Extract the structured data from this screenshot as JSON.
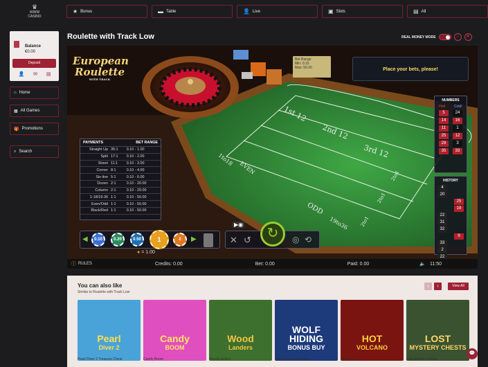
{
  "brand": {
    "line1": "WWW",
    "line2": "CASINO"
  },
  "topnav": [
    {
      "icon": "star-icon",
      "glyph": "★",
      "label": "Bonus"
    },
    {
      "icon": "table-icon",
      "glyph": "▬",
      "label": "Table"
    },
    {
      "icon": "live-icon",
      "glyph": "👤",
      "label": "Live"
    },
    {
      "icon": "slots-icon",
      "glyph": "▣",
      "label": "Slots"
    },
    {
      "icon": "all-icon",
      "glyph": "▤",
      "label": "All"
    }
  ],
  "sidebar": {
    "balance_label": "Balance",
    "balance_value": "€0.00",
    "deposit_label": "Deposit",
    "items": [
      {
        "icon": "home-icon",
        "glyph": "⌂",
        "label": "Home"
      },
      {
        "icon": "grid-icon",
        "glyph": "▦",
        "label": "All Games"
      },
      {
        "icon": "gift-icon",
        "glyph": "🎁",
        "label": "Promotions"
      }
    ],
    "search_label": "Search"
  },
  "page": {
    "title": "Roulette with Track Low",
    "real_money_label": "REAL MONEY MODE"
  },
  "game": {
    "logo_line1": "European",
    "logo_line2": "Roulette",
    "logo_line3": "WITH TRACK",
    "message": "Place your bets, please!",
    "bet_range": {
      "title": "Bet Range",
      "min": "Min: 0.10",
      "max": "Max: 50.00"
    },
    "paytable": {
      "h1": "PAYMENTS",
      "h2": "BET RANGE",
      "rows": [
        [
          "Straight Up",
          "35:1",
          "0.10 - 1.00"
        ],
        [
          "Split",
          "17:1",
          "0.10 - 2.00"
        ],
        [
          "Street",
          "11:1",
          "0.10 - 3.00"
        ],
        [
          "Corner",
          "8:1",
          "0.10 - 4.00"
        ],
        [
          "Six-line",
          "5:1",
          "0.10 - 6.00"
        ],
        [
          "Dozen",
          "2:1",
          "0.10 - 20.00"
        ],
        [
          "Column",
          "2:1",
          "0.10 - 20.00"
        ],
        [
          "1-18/19-36",
          "1:1",
          "0.10 - 50.00"
        ],
        [
          "Even/Odd",
          "1:1",
          "0.10 - 50.00"
        ],
        [
          "Black/Red",
          "1:1",
          "0.10 - 50.00"
        ]
      ]
    },
    "numbers": {
      "title": "NUMBERS",
      "hot_label": "Hot!",
      "cold_label": "Cold!",
      "hot": [
        "5",
        "14",
        "11",
        "25",
        "29",
        "35"
      ],
      "cold": [
        "24",
        "16",
        "1",
        "12",
        "3",
        "33"
      ]
    },
    "history": {
      "title": "HISTORY",
      "values": [
        "4",
        "20",
        "25",
        "19",
        "22",
        "31",
        "32",
        "9",
        "33",
        "2",
        "22"
      ]
    },
    "chips": [
      "0.10",
      "0.20",
      "0.50",
      "1",
      "2"
    ],
    "chip_value": "= 1.00",
    "rules_label": "RULES",
    "credits": "Credits: 0.00",
    "bet": "Bet: 0.00",
    "paid": "Paid: 0.00",
    "time": "11:50",
    "table_labels": {
      "d1": "1st 12",
      "d2": "2nd 12",
      "d3": "3rd 12",
      "low": "1to18",
      "even": "EVEN",
      "odd": "ODD",
      "high": "19to36",
      "col": "2to1",
      "zero": "0"
    }
  },
  "also": {
    "title": "You can also like",
    "subtitle": "Similar to Roulette with Track Low",
    "view_all": "View All",
    "games": [
      {
        "caption": "Pearl Diver 2 Treasure Chest",
        "art1": "Pearl",
        "art2": "Diver 2",
        "bg": "#4aa3d8",
        "fg": "#ffe14a"
      },
      {
        "caption": "Candy Boom",
        "art1": "Candy",
        "art2": "BOOM",
        "bg": "#e04fc0",
        "fg": "#ffe45c"
      },
      {
        "caption": "WoodLanders",
        "art1": "Wood",
        "art2": "Landers",
        "bg": "#3d6f2e",
        "fg": "#f5c542"
      },
      {
        "caption": "Wolf Hiding Bonus Buy",
        "art1": "WOLF HIDING",
        "art2": "BONUS BUY",
        "bg": "#1d3a7a",
        "fg": "#ffffff"
      },
      {
        "caption": "Hot Volcano",
        "art1": "HOT",
        "art2": "VOLCANO",
        "bg": "#7a1410",
        "fg": "#ffcf3a"
      },
      {
        "caption": "Lost Mystery Chests",
        "art1": "LOST",
        "art2": "MYSTERY CHESTS",
        "bg": "#3a5230",
        "fg": "#ffd76a"
      }
    ]
  }
}
